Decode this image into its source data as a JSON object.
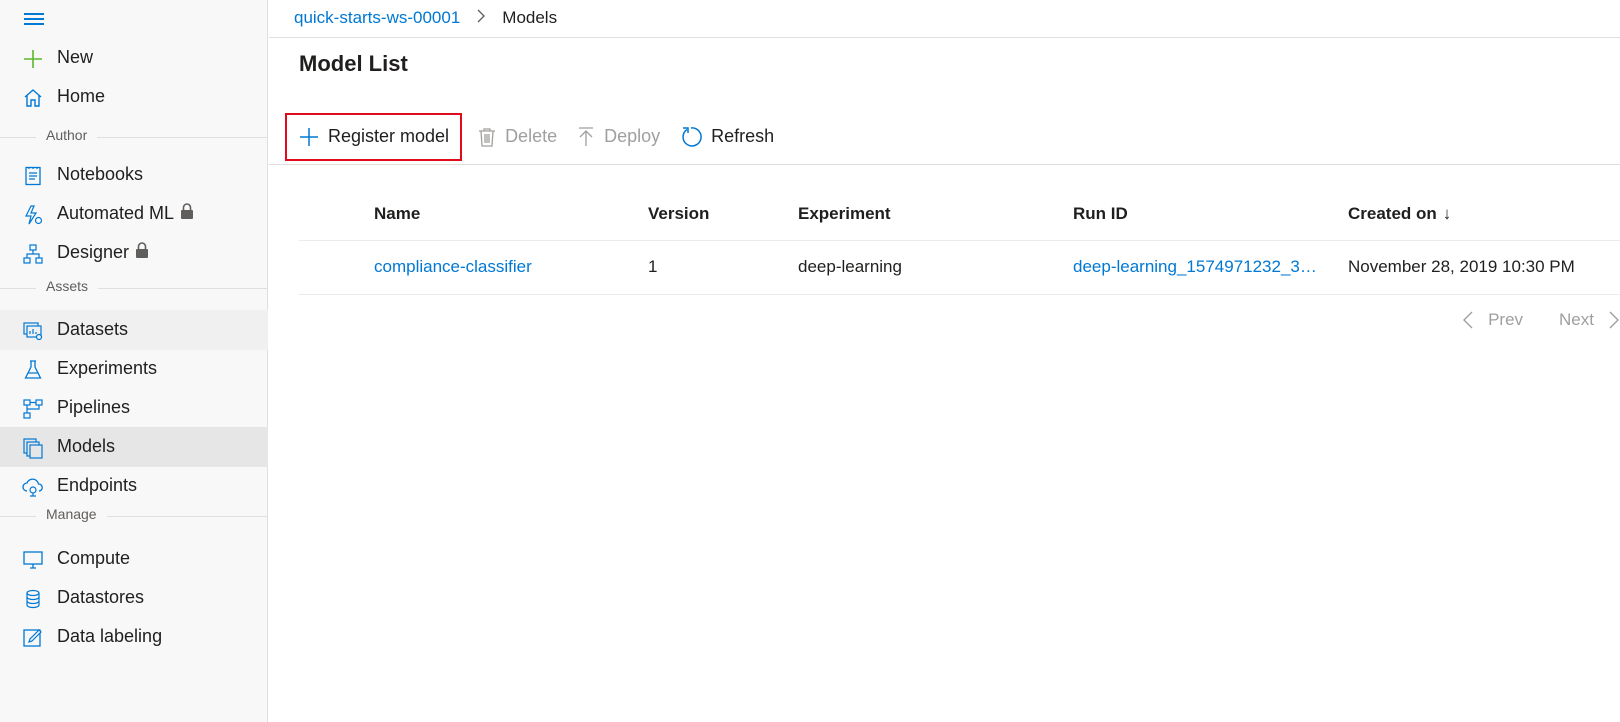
{
  "sidebar": {
    "new_label": "New",
    "home_label": "Home",
    "section_author": "Author",
    "notebooks_label": "Notebooks",
    "automl_label": "Automated ML",
    "designer_label": "Designer",
    "section_assets": "Assets",
    "datasets_label": "Datasets",
    "experiments_label": "Experiments",
    "pipelines_label": "Pipelines",
    "models_label": "Models",
    "endpoints_label": "Endpoints",
    "section_manage": "Manage",
    "compute_label": "Compute",
    "datastores_label": "Datastores",
    "labeling_label": "Data labeling",
    "icons": [
      "menu-icon",
      "plus-icon",
      "home-icon",
      "notebook-icon",
      "automated-ml-icon",
      "lock-icon",
      "designer-icon",
      "datasets-icon",
      "experiments-icon",
      "pipelines-icon",
      "models-icon",
      "endpoints-icon",
      "compute-icon",
      "datastores-icon",
      "data-labeling-icon"
    ]
  },
  "breadcrumb": {
    "workspace": "quick-starts-ws-00001",
    "current": "Models"
  },
  "page": {
    "title": "Model List"
  },
  "toolbar": {
    "register_label": "Register model",
    "delete_label": "Delete",
    "deploy_label": "Deploy",
    "refresh_label": "Refresh"
  },
  "table": {
    "headers": {
      "name": "Name",
      "version": "Version",
      "experiment": "Experiment",
      "run_id": "Run ID",
      "created_on": "Created on"
    },
    "sort_indicator": "↓",
    "rows": [
      {
        "name": "compliance-classifier",
        "version": "1",
        "experiment": "deep-learning",
        "run_id": "deep-learning_1574971232_35...",
        "created_on": "November 28, 2019 10:30 PM"
      }
    ]
  },
  "pager": {
    "prev": "Prev",
    "next": "Next"
  },
  "colors": {
    "accent": "#0078d4",
    "new_plus": "#5cb82a",
    "highlight_border": "#e00b1c",
    "disabled_text": "#a19f9d",
    "sidebar_bg": "#f8f8f8",
    "selected_bg": "#e6e6e6"
  }
}
